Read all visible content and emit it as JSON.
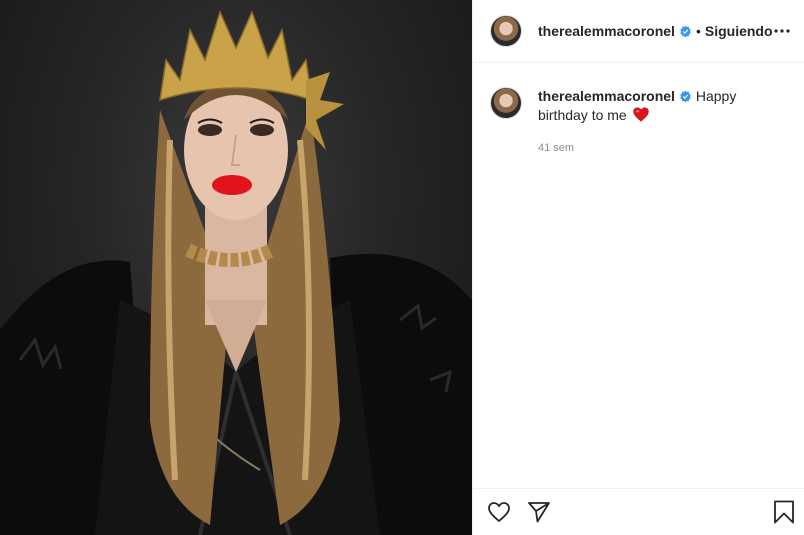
{
  "header": {
    "username": "therealemmacoronel",
    "separator": "•",
    "follow_status": "Siguiendo"
  },
  "caption": {
    "username": "therealemmacoronel",
    "text": "Happy birthday to me"
  },
  "timestamp": "41 sem",
  "media": {
    "description_icon": "photo"
  },
  "icons": {
    "verified": "verified-badge-icon",
    "more": "more-options-icon",
    "like": "heart-outline-icon",
    "share": "paper-plane-icon",
    "save": "bookmark-icon",
    "emoji": "red-heart-emoji"
  },
  "colors": {
    "verified_blue": "#3897f0",
    "text": "#262626",
    "muted": "#8e8e8e",
    "divider": "#efefef"
  }
}
